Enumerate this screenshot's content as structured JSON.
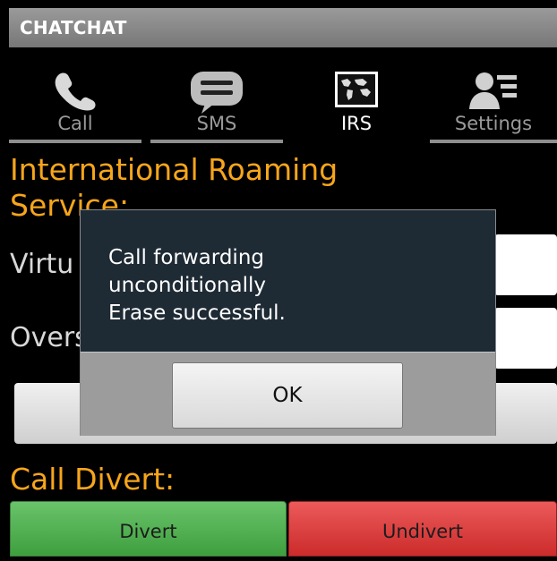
{
  "app": {
    "title": "CHATCHAT"
  },
  "tabs": [
    {
      "label": "Call",
      "icon": "phone-icon",
      "active": false
    },
    {
      "label": "SMS",
      "icon": "sms-icon",
      "active": false
    },
    {
      "label": "IRS",
      "icon": "map-icon",
      "active": true
    },
    {
      "label": "Settings",
      "icon": "settings-icon",
      "active": false
    }
  ],
  "main": {
    "irs_heading": "International Roaming Service:",
    "virtual_label": "Virtu",
    "overseas_label": "Overs",
    "divert_heading": "Call Divert:",
    "divert_button": "Divert",
    "undivert_button": "Undivert"
  },
  "dialog": {
    "message_line1": "Call forwarding",
    "message_line2": "unconditionally",
    "message_line3": "Erase successful.",
    "ok_label": "OK"
  },
  "colors": {
    "accent_orange": "#f7a51b",
    "divert_green": "#55b455",
    "undivert_red": "#dd3a3a"
  }
}
